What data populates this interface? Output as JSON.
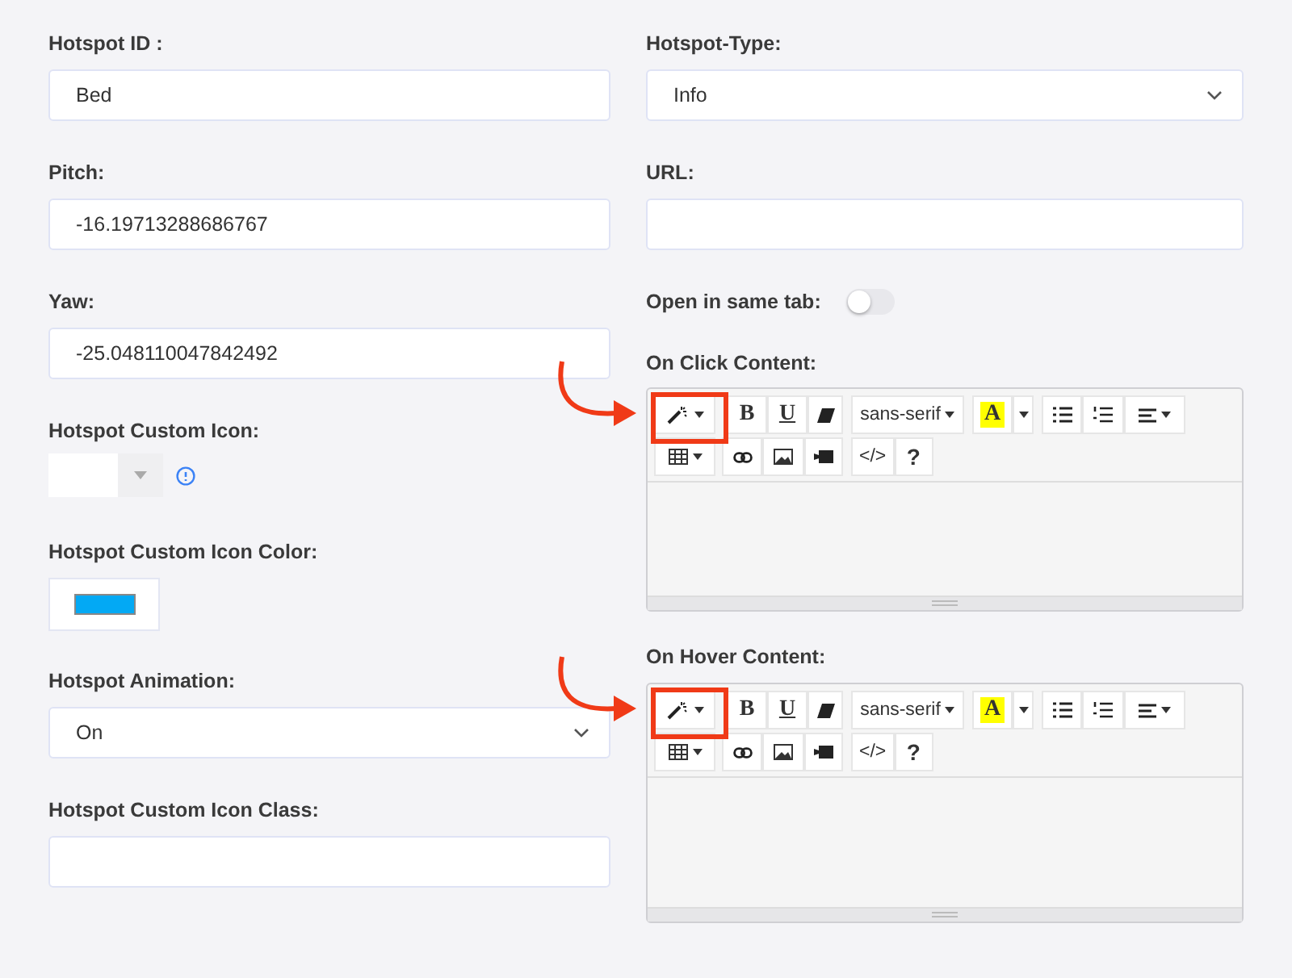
{
  "left_fields": [
    {
      "kind": "text",
      "label": "Hotspot ID :",
      "value": "Bed"
    },
    {
      "kind": "text",
      "label": "Pitch:",
      "value": "-16.19713288686767"
    },
    {
      "kind": "text",
      "label": "Yaw:",
      "value": "-25.048110047842492"
    },
    {
      "kind": "icon_picker",
      "label": "Hotspot Custom Icon:"
    },
    {
      "kind": "color",
      "label": "Hotspot Custom Icon Color:",
      "color": "#03a9f4"
    },
    {
      "kind": "select",
      "label": "Hotspot Animation:",
      "value": "On"
    },
    {
      "kind": "text",
      "label": "Hotspot Custom Icon Class:"
    }
  ],
  "hotspot_type": {
    "label": "Hotspot-Type:",
    "value": "Info"
  },
  "url": {
    "label": "URL:"
  },
  "open_in_same_tab": {
    "label": "Open in same tab:",
    "on": false
  },
  "editors": [
    {
      "label": "On Click Content:",
      "highlighted": true,
      "toolbar": {
        "bold": "B",
        "underline": "U",
        "font": "sans-serif",
        "text_color_letter": "A",
        "code": "</>",
        "help": "?"
      }
    },
    {
      "label": "On Hover Content:",
      "highlighted": true,
      "toolbar": {
        "bold": "B",
        "underline": "U",
        "font": "sans-serif",
        "text_color_letter": "A",
        "code": "</>",
        "help": "?"
      }
    }
  ]
}
